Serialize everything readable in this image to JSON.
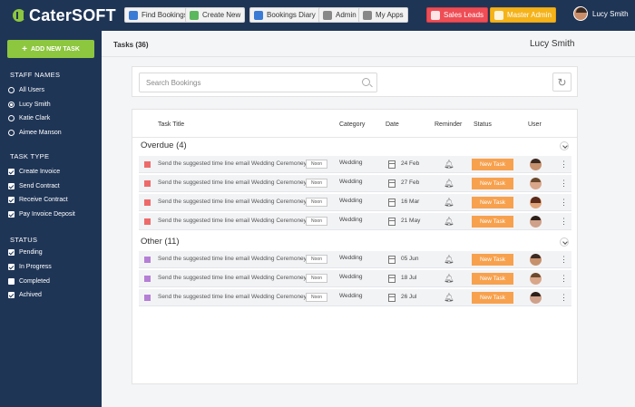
{
  "app": {
    "logo_text": "CaterSOFT"
  },
  "topbar": {
    "buttons": [
      {
        "label": "Find Bookings",
        "icon": "search-icon",
        "icon_color": "#3a7bd5"
      },
      {
        "label": "Create New",
        "icon": "plus-icon",
        "icon_color": "#5cb85c"
      },
      {
        "label": "Bookings Diary",
        "icon": "diary-icon",
        "icon_color": "#3a7bd5"
      },
      {
        "label": "Admin",
        "icon": "tools-icon",
        "icon_color": "#777777"
      },
      {
        "label": "My Apps",
        "icon": "apps-icon",
        "icon_color": "#777777"
      },
      {
        "label": "Sales Leads",
        "icon": "chart-icon",
        "color": "#ee4d55"
      },
      {
        "label": "Master Admin",
        "icon": "lock-icon",
        "color": "#f5b31a"
      }
    ],
    "user_name": "Lucy Smith"
  },
  "sidebar": {
    "add_task_label": "ADD NEW TASK",
    "staff_title": "STAFF NAMES",
    "staff": [
      {
        "label": "All Users",
        "selected": false
      },
      {
        "label": "Lucy Smith",
        "selected": true
      },
      {
        "label": "Katie Clark",
        "selected": false
      },
      {
        "label": "Aimee Manson",
        "selected": false
      }
    ],
    "task_type_title": "TASK TYPE",
    "task_types": [
      {
        "label": "Create Invoice",
        "checked": true
      },
      {
        "label": "Send Contract",
        "checked": true
      },
      {
        "label": "Receive Contract",
        "checked": true
      },
      {
        "label": "Pay Invoice Deposit",
        "checked": true
      }
    ],
    "status_title": "STATUS",
    "statuses": [
      {
        "label": "Pending",
        "checked": true
      },
      {
        "label": "In Progress",
        "checked": true
      },
      {
        "label": "Completed",
        "checked": false
      },
      {
        "label": "Achived",
        "checked": true
      }
    ]
  },
  "main": {
    "tasks_count": "Tasks (36)",
    "user_name": "Lucy Smith",
    "search_placeholder": "Search Bookings",
    "columns": [
      "Task Title",
      "Category",
      "Date",
      "Reminder",
      "Status",
      "User"
    ],
    "groups": [
      {
        "title": "Overdue (4)",
        "color": "#ee6a6a",
        "rows": [
          {
            "title": "Send the suggested time line email Wedding Ceremoney",
            "time": "Noon",
            "category": "Wedding",
            "date": "24 Feb",
            "status": "New Task"
          },
          {
            "title": "Send the suggested time line email Wedding Ceremoney",
            "time": "Noon",
            "category": "Wedding",
            "date": "27 Feb",
            "status": "New Task"
          },
          {
            "title": "Send the suggested time line email Wedding Ceremoney",
            "time": "Noon",
            "category": "Wedding",
            "date": "16 Mar",
            "status": "New Task"
          },
          {
            "title": "Send the suggested time line email Wedding Ceremoney",
            "time": "Noon",
            "category": "Wedding",
            "date": "21 May",
            "status": "New Task"
          }
        ]
      },
      {
        "title": "Other (11)",
        "color": "#b57fd6",
        "rows": [
          {
            "title": "Send the suggested time line email Wedding Ceremoney",
            "time": "Noon",
            "category": "Wedding",
            "date": "05 Jun",
            "status": "New Task"
          },
          {
            "title": "Send the suggested time line email Wedding Ceremoney",
            "time": "Noon",
            "category": "Wedding",
            "date": "18 Jul",
            "status": "New Task"
          },
          {
            "title": "Send the suggested time line email Wedding Ceremoney",
            "time": "Noon",
            "category": "Wedding",
            "date": "26 Jul",
            "status": "New Task"
          }
        ]
      }
    ]
  }
}
